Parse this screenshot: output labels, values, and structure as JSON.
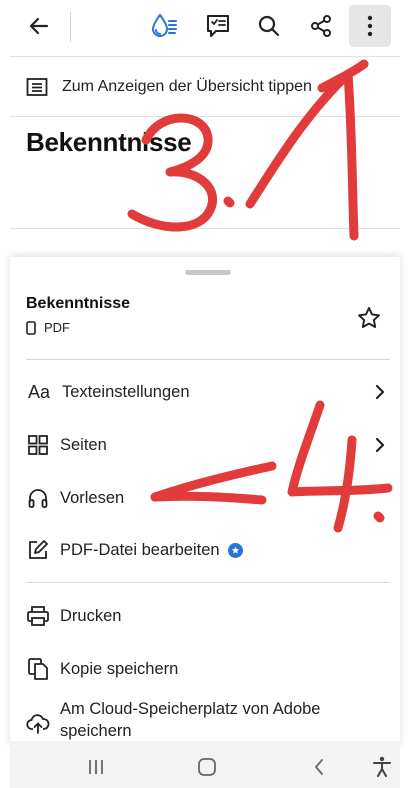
{
  "toolbar": {
    "icons": [
      "back-arrow-icon",
      "liquid-mode-icon",
      "comment-icon",
      "search-icon",
      "share-icon",
      "more-vertical-icon"
    ]
  },
  "outline_hint": {
    "label": "Zum Anzeigen der Übersicht tippen"
  },
  "document": {
    "title": "Bekenntnisse"
  },
  "sheet": {
    "title": "Bekenntnisse",
    "file_type": "PDF",
    "menu": {
      "text_settings": "Texteinstellungen",
      "pages": "Seiten",
      "read_aloud": "Vorlesen",
      "edit_pdf": "PDF-Datei bearbeiten",
      "print": "Drucken",
      "save_copy": "Kopie speichern",
      "cloud_save": "Am Cloud-Speicherplatz von Adobe speichern"
    },
    "text_icon_glyph": "Aa"
  },
  "annotations": {
    "step_three": "3.1",
    "step_four": "4."
  },
  "colors": {
    "accent_blue": "#2b73d6",
    "annotation_red": "#e23b3b",
    "highlight_bg": "#e6e6e6"
  }
}
